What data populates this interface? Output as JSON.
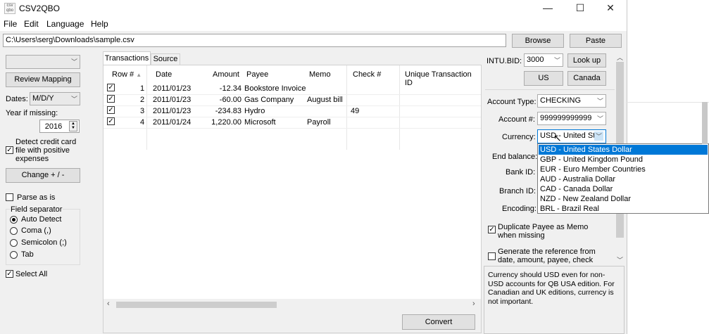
{
  "window": {
    "title": "CSV2QBO",
    "icon_text": "csv qbo",
    "controls": {
      "minimize": "—",
      "maximize": "☐",
      "close": "✕"
    }
  },
  "menu": [
    "File",
    "Edit",
    "Language",
    "Help"
  ],
  "path": {
    "value": "C:\\Users\\serg\\Downloads\\sample.csv",
    "browse": "Browse",
    "paste": "Paste"
  },
  "left": {
    "review_mapping": "Review Mapping",
    "dates_label": "Dates:",
    "dates_value": "M/D/Y",
    "year_label": "Year if missing:",
    "year_value": "2016",
    "detect_credit": "Detect credit card file with positive expenses",
    "change_sign": "Change + / -",
    "parse_as_is": "Parse as is",
    "field_separator": "Field separator",
    "separators": [
      "Auto Detect",
      "Coma (,)",
      "Semicolon (;)",
      "Tab"
    ],
    "select_all": "Select All"
  },
  "tabs": [
    "Transactions",
    "Source"
  ],
  "table": {
    "headers": [
      "Row #",
      "Date",
      "Amount",
      "Payee",
      "Memo",
      "Check #",
      "Unique Transaction ID"
    ],
    "rows": [
      [
        "1",
        "2011/01/23",
        "-12.34",
        "Bookstore Invoice",
        "",
        ""
      ],
      [
        "2",
        "2011/01/23",
        "-60.00",
        "Gas Company",
        "August bill",
        ""
      ],
      [
        "3",
        "2011/01/23",
        "-234.83",
        "Hydro",
        "",
        "49"
      ],
      [
        "4",
        "2011/01/24",
        "1,220.00",
        "Microsoft",
        "Payroll",
        ""
      ]
    ]
  },
  "convert": "Convert",
  "right": {
    "intu_label": "INTU.BID:",
    "intu_value": "3000",
    "look_up": "Look up",
    "us": "US",
    "canada": "Canada",
    "account_type_label": "Account Type:",
    "account_type_value": "CHECKING",
    "account_num_label": "Account #:",
    "account_num_value": "999999999999",
    "currency_label": "Currency:",
    "currency_value": "USD - United Sta",
    "end_balance_label": "End balance:",
    "bank_id_label": "Bank ID:",
    "branch_id_label": "Branch ID:",
    "encoding_label": "Encoding:",
    "dup_payee": "Duplicate Payee as Memo when missing",
    "gen_ref": "Generate the reference from date, amount, payee, check",
    "hint": "Currency should USD even for non-USD accounts for QB USA edition. For Canadian and UK editions, currency is not important."
  },
  "currency_options": [
    "USD - United States Dollar",
    "GBP - United Kingdom Pound",
    "EUR - Euro Member Countries",
    "AUD - Australia Dollar",
    "CAD - Canada Dollar",
    "NZD - New Zealand Dollar",
    "BRL - Brazil Real"
  ]
}
